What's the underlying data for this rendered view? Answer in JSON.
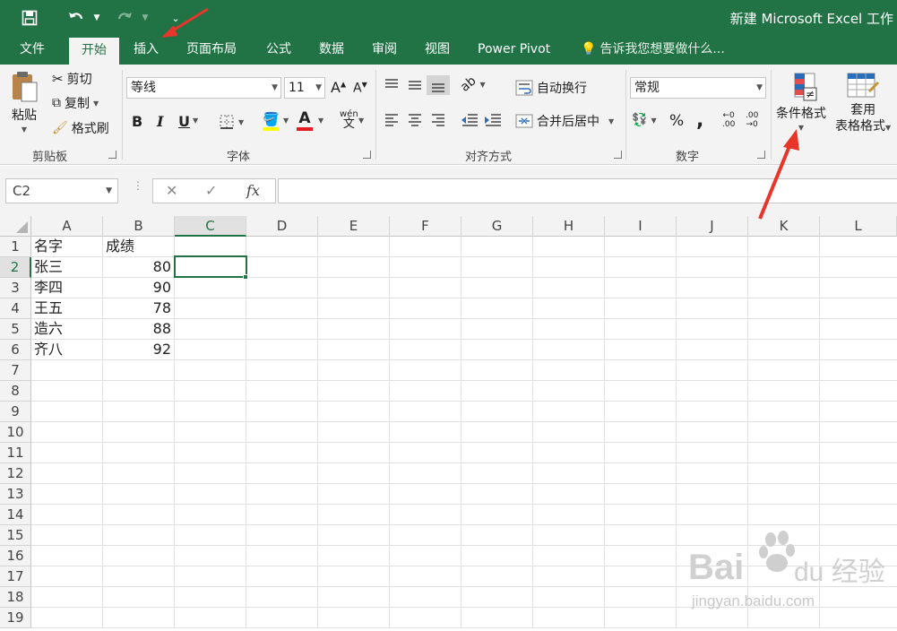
{
  "window": {
    "title": "新建 Microsoft Excel 工作",
    "qat": {
      "save": "save-icon",
      "undo": "undo-icon",
      "redo": "redo-icon",
      "customize": "customize-icon"
    }
  },
  "ribbon_tabs": [
    {
      "label": "文件"
    },
    {
      "label": "开始"
    },
    {
      "label": "插入"
    },
    {
      "label": "页面布局"
    },
    {
      "label": "公式"
    },
    {
      "label": "数据"
    },
    {
      "label": "审阅"
    },
    {
      "label": "视图"
    },
    {
      "label": "Power Pivot"
    }
  ],
  "active_tab": "开始",
  "tell_me": "告诉我您想要做什么...",
  "clipboard": {
    "paste": "粘贴",
    "cut": "剪切",
    "copy": "复制",
    "format_painter": "格式刷",
    "group": "剪贴板"
  },
  "font": {
    "name": "等线",
    "size": "11",
    "bold": "B",
    "italic": "I",
    "underline": "U",
    "group": "字体",
    "fill_color": "#ffff00",
    "font_color": "#e51c23",
    "phonetic_top": "wén",
    "phonetic_bottom": "文"
  },
  "alignment": {
    "wrap": "自动换行",
    "merge": "合并后居中",
    "group": "对齐方式"
  },
  "number": {
    "format": "常规",
    "percent": "%",
    "comma": ",",
    "inc_decimal_top": "←0",
    "inc_decimal_bottom": ".00",
    "dec_decimal_top": ".00",
    "dec_decimal_bottom": "→0",
    "group": "数字"
  },
  "styles": {
    "cond_format": "条件格式",
    "table_format_1": "套用",
    "table_format_2": "表格格式"
  },
  "formula_bar": {
    "name_box": "C2",
    "cancel": "✕",
    "enter": "✓",
    "fx": "fx",
    "content": ""
  },
  "sheet": {
    "columns": [
      "A",
      "B",
      "C",
      "D",
      "E",
      "F",
      "G",
      "H",
      "I",
      "J",
      "K",
      "L"
    ],
    "rows": [
      "1",
      "2",
      "3",
      "4",
      "5",
      "6",
      "7",
      "8",
      "9",
      "10",
      "11",
      "12",
      "13",
      "14",
      "15",
      "16",
      "17",
      "18",
      "19"
    ],
    "cells": {
      "A1": "名字",
      "B1": "成绩",
      "A2": "张三",
      "B2": "80",
      "A3": "李四",
      "B3": "90",
      "A4": "王五",
      "B4": "78",
      "A5": "造六",
      "B5": "88",
      "A6": "齐八",
      "B6": "92"
    },
    "selected": "C2"
  },
  "watermark": {
    "brand": "Bai du 经验",
    "url": "jingyan.baidu.com"
  },
  "annotation_color": "#e8352a"
}
